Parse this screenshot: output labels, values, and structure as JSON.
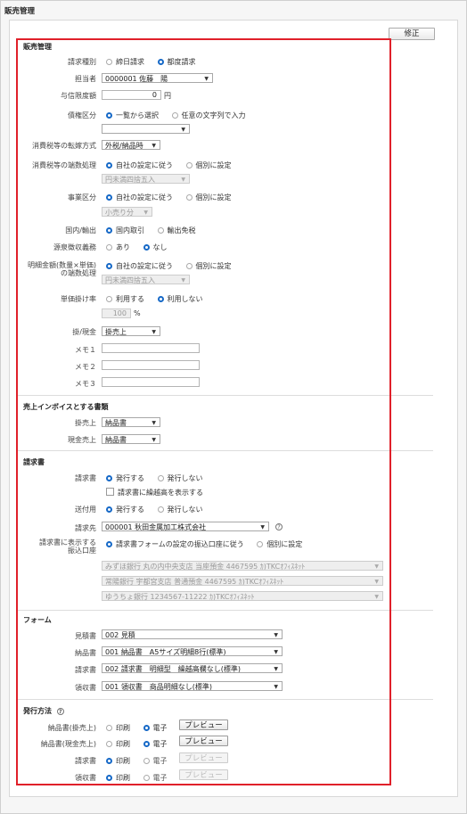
{
  "page": {
    "title": "販売管理",
    "edit_label": "修正"
  },
  "sales": {
    "heading": "販売管理",
    "billing_type": {
      "label": "請求種別",
      "opt1": "締日請求",
      "opt2": "都度請求"
    },
    "staff": {
      "label": "担当者",
      "value": "0000001 佐藤　陽"
    },
    "credit_limit": {
      "label": "与信限度額",
      "value": "0",
      "unit": "円"
    },
    "receivable": {
      "label": "債権区分",
      "opt1": "一覧から選択",
      "opt2": "任意の文字列で入力",
      "select_value": ""
    },
    "tax_method": {
      "label": "消費税等の転嫁方式",
      "value": "外税/納品時"
    },
    "tax_rounding": {
      "label": "消費税等の端数処理",
      "opt1": "自社の設定に従う",
      "opt2": "個別に設定",
      "select_value": "円未満四捨五入"
    },
    "business_type": {
      "label": "事業区分",
      "opt1": "自社の設定に従う",
      "opt2": "個別に設定",
      "select_value": "小売り分"
    },
    "domestic": {
      "label": "国内/輸出",
      "opt1": "国内取引",
      "opt2": "輸出免税"
    },
    "withholding": {
      "label": "源泉徴収義務",
      "opt1": "あり",
      "opt2": "なし"
    },
    "detail_rounding": {
      "label1": "明細金額(数量×単価)",
      "label2": "の端数処理",
      "opt1": "自社の設定に従う",
      "opt2": "個別に設定",
      "select_value": "円未満四捨五入"
    },
    "unit_rate": {
      "label": "単価掛け率",
      "opt1": "利用する",
      "opt2": "利用しない",
      "value": "100",
      "unit": "%"
    },
    "credit_cash": {
      "label": "掛/現金",
      "value": "掛売上"
    },
    "memo1": {
      "label": "メモ１",
      "value": ""
    },
    "memo2": {
      "label": "メモ２",
      "value": ""
    },
    "memo3": {
      "label": "メモ３",
      "value": ""
    }
  },
  "invoice_docs": {
    "heading": "売上インボイスとする書類",
    "credit": {
      "label": "掛売上",
      "value": "納品書"
    },
    "cash": {
      "label": "現金売上",
      "value": "納品書"
    }
  },
  "invoice": {
    "heading": "請求書",
    "issue": {
      "label": "請求書",
      "opt1": "発行する",
      "opt2": "発行しない"
    },
    "carryover_label": "請求書に繰越高を表示する",
    "cover": {
      "label": "送付用",
      "opt1": "発行する",
      "opt2": "発行しない"
    },
    "destination": {
      "label": "請求先",
      "value": "000001 秋田金属加工株式会社"
    },
    "bank": {
      "label1": "請求書に表示する",
      "label2": "振込口座",
      "opt1": "請求書フォームの設定の振込口座に従う",
      "opt2": "個別に設定"
    },
    "bank_accounts": [
      "みずほ銀行 丸の内中央支店 当座預金 4467595 ｶ)TKCｵﾌｨｽﾈｯﾄ",
      "常陽銀行 宇都宮支店 普通預金 4467595 ｶ)TKCｵﾌｨｽﾈｯﾄ",
      "ゆうちょ銀行 1234567-11222 ｶ)TKCｵﾌｨｽﾈｯﾄ"
    ]
  },
  "forms": {
    "heading": "フォーム",
    "estimate": {
      "label": "見積書",
      "value": "002 見積"
    },
    "delivery": {
      "label": "納品書",
      "value": "001 納品書　A5サイズ明細8行(標準)"
    },
    "invoice": {
      "label": "請求書",
      "value": "002 請求書　明細型　繰越高欄なし(標準)"
    },
    "receipt": {
      "label": "領収書",
      "value": "001 領収書　商品明細なし(標準)"
    }
  },
  "issue_method": {
    "heading": "発行方法",
    "print_label": "印刷",
    "email_label": "電子",
    "preview_label": "プレビュー",
    "rows": [
      {
        "label": "納品書(掛売上)"
      },
      {
        "label": "納品書(現金売上)"
      },
      {
        "label": "請求書"
      },
      {
        "label": "領収書"
      }
    ]
  }
}
